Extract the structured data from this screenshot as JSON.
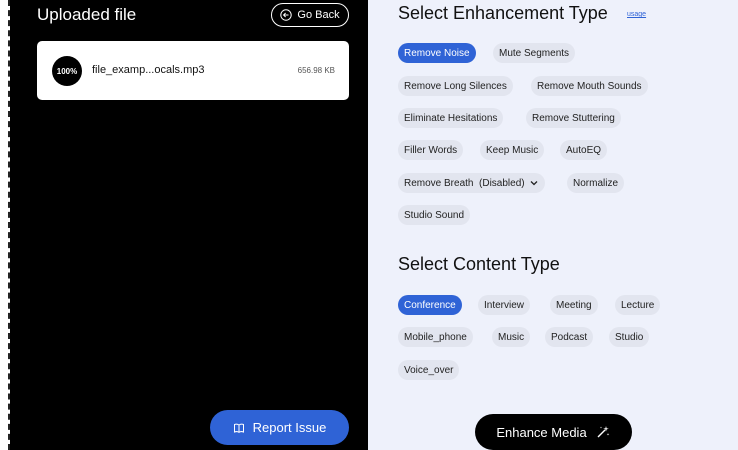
{
  "upload": {
    "title": "Uploaded file",
    "go_back_label": "Go Back",
    "file": {
      "progress": "100%",
      "name": "file_examp...ocals.mp3",
      "size": "656.98 KB"
    },
    "report_label": "Report Issue"
  },
  "enhancement": {
    "title": "Select Enhancement Type",
    "usage_label": "usage",
    "options": [
      {
        "label": "Remove Noise",
        "selected": true
      },
      {
        "label": "Mute Segments",
        "selected": false
      },
      {
        "label": "Remove Long Silences",
        "selected": false
      },
      {
        "label": "Remove Mouth Sounds",
        "selected": false
      },
      {
        "label": "Eliminate Hesitations",
        "selected": false
      },
      {
        "label": "Remove Stuttering",
        "selected": false
      },
      {
        "label": "Filler Words",
        "selected": false
      },
      {
        "label": "Keep Music",
        "selected": false
      },
      {
        "label": "AutoEQ",
        "selected": false
      },
      {
        "label": "Remove Breath  (Disabled)",
        "selected": false,
        "has_dropdown": true
      },
      {
        "label": "Normalize",
        "selected": false
      },
      {
        "label": "Studio Sound",
        "selected": false
      }
    ]
  },
  "content": {
    "title": "Select Content Type",
    "options": [
      {
        "label": "Conference",
        "selected": true
      },
      {
        "label": "Interview",
        "selected": false
      },
      {
        "label": "Meeting",
        "selected": false
      },
      {
        "label": "Lecture",
        "selected": false
      },
      {
        "label": "Mobile_phone",
        "selected": false
      },
      {
        "label": "Music",
        "selected": false
      },
      {
        "label": "Podcast",
        "selected": false
      },
      {
        "label": "Studio",
        "selected": false
      },
      {
        "label": "Voice_over",
        "selected": false
      }
    ]
  },
  "enhance_label": "Enhance Media",
  "colors": {
    "accent": "#2f63d6",
    "chip_bg": "#e2e5ef",
    "panel_bg": "#eef1fb",
    "left_bg": "#000000"
  },
  "icons": [
    "arrow-left-icon",
    "chevron-down-icon",
    "book-icon",
    "magic-wand-icon"
  ]
}
